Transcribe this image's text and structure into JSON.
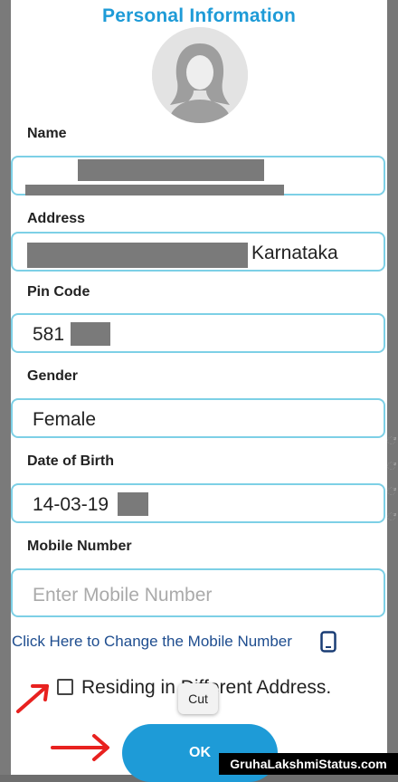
{
  "dialog": {
    "title": "Personal Information"
  },
  "form": {
    "name": {
      "label": "Name",
      "value": ""
    },
    "address": {
      "label": "Address",
      "value": "Karnataka"
    },
    "pin_code": {
      "label": "Pin Code",
      "value": "581"
    },
    "gender": {
      "label": "Gender",
      "value": "Female"
    },
    "date_of_birth": {
      "label": "Date of Birth",
      "value": "14-03-19"
    },
    "mobile_number": {
      "label": "Mobile Number",
      "placeholder": "Enter Mobile Number"
    }
  },
  "change_mobile_link": "Click Here to Change the Mobile Number",
  "different_address_checkbox": {
    "label": "Residing in Different Address.",
    "checked": false
  },
  "context_menu": {
    "cut_label": "Cut"
  },
  "ok_button_label": "OK",
  "watermark": "GruhaLakshmiStatus.com",
  "colors": {
    "accent": "#1e9bd7",
    "field_border": "#7dd0e6",
    "annotation_red": "#e8211f"
  },
  "icons": [
    "user-avatar-icon",
    "mobile-phone-icon",
    "red-arrow-icon"
  ]
}
